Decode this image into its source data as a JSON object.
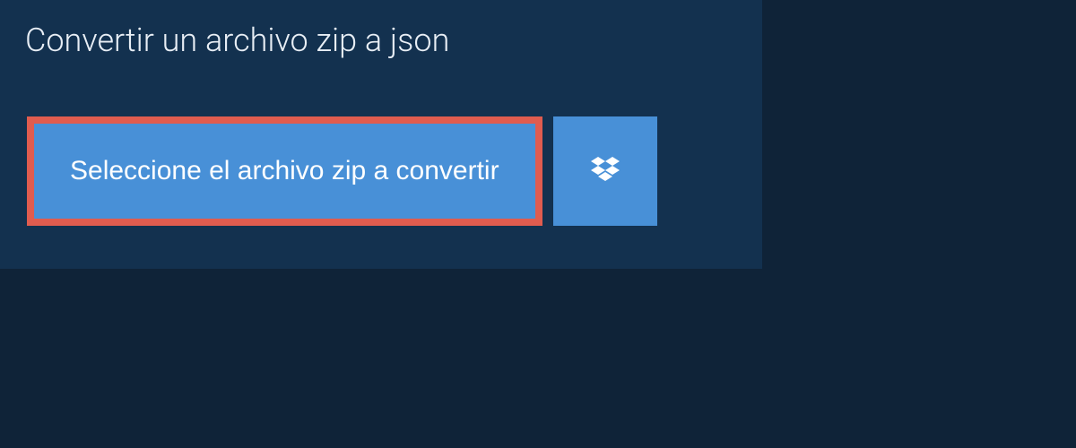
{
  "tab": {
    "title": "Convertir un archivo zip a json"
  },
  "actions": {
    "select_file_label": "Seleccione el archivo zip a convertir"
  },
  "colors": {
    "background": "#0f2338",
    "panel": "#13314f",
    "button": "#4890d7",
    "highlight_border": "#e05c4f"
  }
}
